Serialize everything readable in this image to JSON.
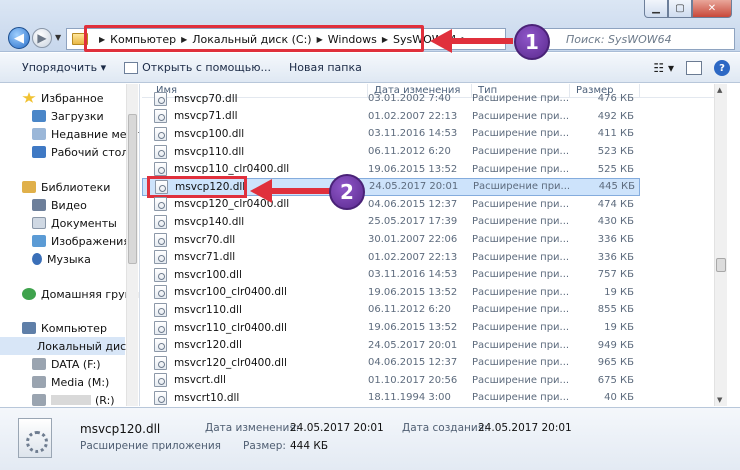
{
  "address": {
    "crumbs": [
      "Компьютер",
      "Локальный диск (C:)",
      "Windows",
      "SysWOW64"
    ]
  },
  "search": {
    "placeholder": "Поиск: SysWOW64"
  },
  "toolbar": {
    "organize": "Упорядочить ▾",
    "open_with": "Открыть с помощью...",
    "new_folder": "Новая папка"
  },
  "sidebar": {
    "items": [
      {
        "label": "Избранное",
        "icon": "star-icon"
      },
      {
        "label": "Загрузки",
        "icon": "downloads-icon"
      },
      {
        "label": "Недавние места",
        "icon": "recent-places-icon"
      },
      {
        "label": "Рабочий стол",
        "icon": "desktop-icon"
      },
      {
        "label": "Библиотеки",
        "icon": "libraries-icon"
      },
      {
        "label": "Видео",
        "icon": "video-icon"
      },
      {
        "label": "Документы",
        "icon": "documents-icon"
      },
      {
        "label": "Изображения",
        "icon": "images-icon"
      },
      {
        "label": "Музыка",
        "icon": "music-icon"
      },
      {
        "label": "Домашняя группа",
        "icon": "homegroup-icon"
      },
      {
        "label": "Компьютер",
        "icon": "computer-icon"
      },
      {
        "label": "Локальный диск",
        "icon": "local-disk-icon"
      },
      {
        "label": "DATA (F:)",
        "icon": "drive-icon"
      },
      {
        "label": "Media (M:)",
        "icon": "drive-icon"
      },
      {
        "label": "(R:)",
        "icon": "drive-icon"
      }
    ]
  },
  "columns": {
    "name": "Имя",
    "date": "Дата изменения",
    "type": "Тип",
    "size": "Размер"
  },
  "files": [
    {
      "name": "msvcp70.dll",
      "date": "03.01.2002 7:40",
      "type": "Расширение при...",
      "size": "476 КБ"
    },
    {
      "name": "msvcp71.dll",
      "date": "01.02.2007 22:13",
      "type": "Расширение при...",
      "size": "492 КБ"
    },
    {
      "name": "msvcp100.dll",
      "date": "03.11.2016 14:53",
      "type": "Расширение при...",
      "size": "411 КБ"
    },
    {
      "name": "msvcp110.dll",
      "date": "06.11.2012 6:20",
      "type": "Расширение при...",
      "size": "523 КБ"
    },
    {
      "name": "msvcp110_clr0400.dll",
      "date": "19.06.2015 13:52",
      "type": "Расширение при...",
      "size": "525 КБ"
    },
    {
      "name": "msvcp120.dll",
      "date": "24.05.2017 20:01",
      "type": "Расширение при...",
      "size": "445 КБ"
    },
    {
      "name": "msvcp120_clr0400.dll",
      "date": "04.06.2015 12:37",
      "type": "Расширение при...",
      "size": "474 КБ"
    },
    {
      "name": "msvcp140.dll",
      "date": "25.05.2017 17:39",
      "type": "Расширение при...",
      "size": "430 КБ"
    },
    {
      "name": "msvcr70.dll",
      "date": "30.01.2007 22:06",
      "type": "Расширение при...",
      "size": "336 КБ"
    },
    {
      "name": "msvcr71.dll",
      "date": "01.02.2007 22:13",
      "type": "Расширение при...",
      "size": "336 КБ"
    },
    {
      "name": "msvcr100.dll",
      "date": "03.11.2016 14:53",
      "type": "Расширение при...",
      "size": "757 КБ"
    },
    {
      "name": "msvcr100_clr0400.dll",
      "date": "19.06.2015 13:52",
      "type": "Расширение при...",
      "size": "19 КБ"
    },
    {
      "name": "msvcr110.dll",
      "date": "06.11.2012 6:20",
      "type": "Расширение при...",
      "size": "855 КБ"
    },
    {
      "name": "msvcr110_clr0400.dll",
      "date": "19.06.2015 13:52",
      "type": "Расширение при...",
      "size": "19 КБ"
    },
    {
      "name": "msvcr120.dll",
      "date": "24.05.2017 20:01",
      "type": "Расширение при...",
      "size": "949 КБ"
    },
    {
      "name": "msvcr120_clr0400.dll",
      "date": "04.06.2015 12:37",
      "type": "Расширение при...",
      "size": "965 КБ"
    },
    {
      "name": "msvcrt.dll",
      "date": "01.10.2017 20:56",
      "type": "Расширение при...",
      "size": "675 КБ"
    },
    {
      "name": "msvcrt10.dll",
      "date": "18.11.1994 3:00",
      "type": "Расширение при...",
      "size": "40 КБ"
    }
  ],
  "selected_index": 5,
  "details": {
    "name": "msvcp120.dll",
    "type": "Расширение приложения",
    "modified_label": "Дата изменения:",
    "modified_value": "24.05.2017 20:01",
    "created_label": "Дата создания:",
    "created_value": "24.05.2017 20:01",
    "size_label": "Размер:",
    "size_value": "444 КБ"
  },
  "annotations": {
    "badge1": "1",
    "badge2": "2",
    "color": "#e0303c"
  }
}
